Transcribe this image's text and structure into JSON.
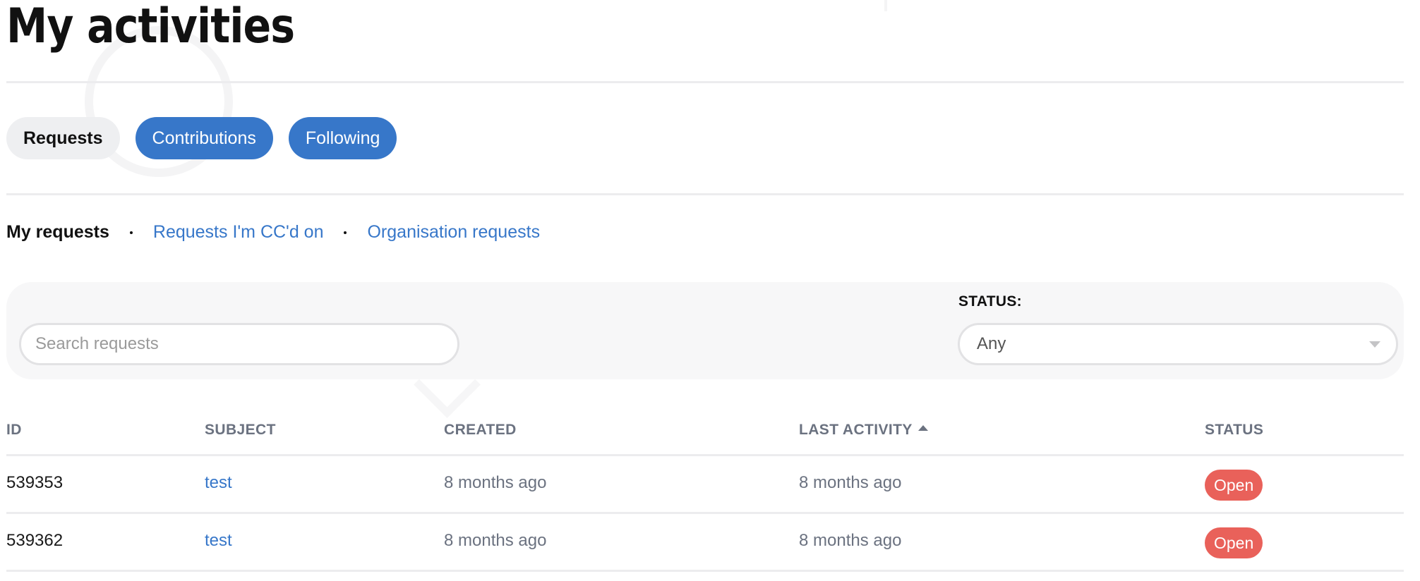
{
  "page": {
    "title": "My activities"
  },
  "tabs": [
    {
      "label": "Requests",
      "active": true
    },
    {
      "label": "Contributions",
      "active": false
    },
    {
      "label": "Following",
      "active": false
    }
  ],
  "subnav": {
    "current": "My requests",
    "links": [
      "Requests I'm CC'd on",
      "Organisation requests"
    ]
  },
  "filters": {
    "search_placeholder": "Search requests",
    "search_value": "",
    "status_label": "STATUS:",
    "status_selected": "Any"
  },
  "table": {
    "columns": [
      "ID",
      "SUBJECT",
      "CREATED",
      "LAST ACTIVITY",
      "STATUS"
    ],
    "sorted_column": "LAST ACTIVITY",
    "sort_direction": "ascending",
    "rows": [
      {
        "id": "539353",
        "subject": "test",
        "created": "8 months ago",
        "last_activity": "8 months ago",
        "status": "Open"
      },
      {
        "id": "539362",
        "subject": "test",
        "created": "8 months ago",
        "last_activity": "8 months ago",
        "status": "Open"
      }
    ]
  },
  "colors": {
    "accent": "#3777c9",
    "status_open": "#e9615a",
    "active_tab_bg": "#eeeff1"
  }
}
